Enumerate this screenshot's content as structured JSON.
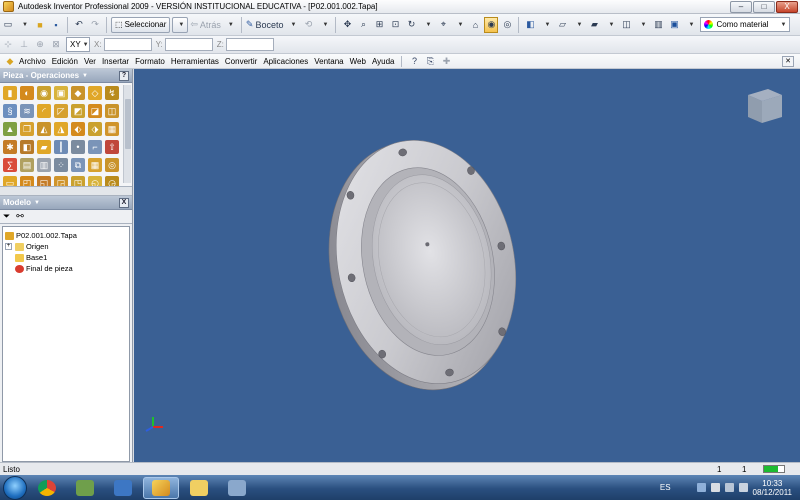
{
  "window": {
    "title": "Autodesk Inventor Professional 2009 - VERSIÓN INSTITUCIONAL EDUCATIVA - [P02.001.002.Tapa]",
    "controls": {
      "minimize": "–",
      "maximize": "□",
      "close": "X"
    }
  },
  "toolbar": {
    "select_label": "Seleccionar",
    "back_label": "Atrás",
    "sketch_label": "Boceto",
    "material_label": "Como material"
  },
  "coords": {
    "plane": "XY",
    "x_label": "X:",
    "y_label": "Y:",
    "z_label": "Z:"
  },
  "menu": {
    "items": [
      "Archivo",
      "Edición",
      "Ver",
      "Insertar",
      "Formato",
      "Herramientas",
      "Convertir",
      "Aplicaciones",
      "Ventana",
      "Web",
      "Ayuda"
    ],
    "underline": [
      "A",
      "E",
      "V",
      "I",
      "F",
      "H",
      "C",
      "A",
      "n",
      "W",
      "A"
    ]
  },
  "operations_panel": {
    "title": "Pieza - Operaciones",
    "close": "?"
  },
  "model_panel": {
    "title": "Modelo",
    "close": "X",
    "tree": [
      {
        "label": "P02.001.002.Tapa",
        "icon": "part-icon",
        "level": 0
      },
      {
        "label": "Origen",
        "icon": "folder-icon",
        "level": 1,
        "expandable": true
      },
      {
        "label": "Base1",
        "icon": "extrude-icon",
        "level": 1
      },
      {
        "label": "Final de pieza",
        "icon": "end-of-part-icon",
        "level": 1
      }
    ]
  },
  "status": {
    "text": "Listo",
    "count_a": "1",
    "count_b": "1"
  },
  "taskbar": {
    "language": "ES",
    "time": "10:33",
    "date": "08/12/2011"
  },
  "colors": {
    "viewport_bg": "#3a6094",
    "accent": "#f5c24e",
    "part_metal": "#c8c8cc"
  }
}
